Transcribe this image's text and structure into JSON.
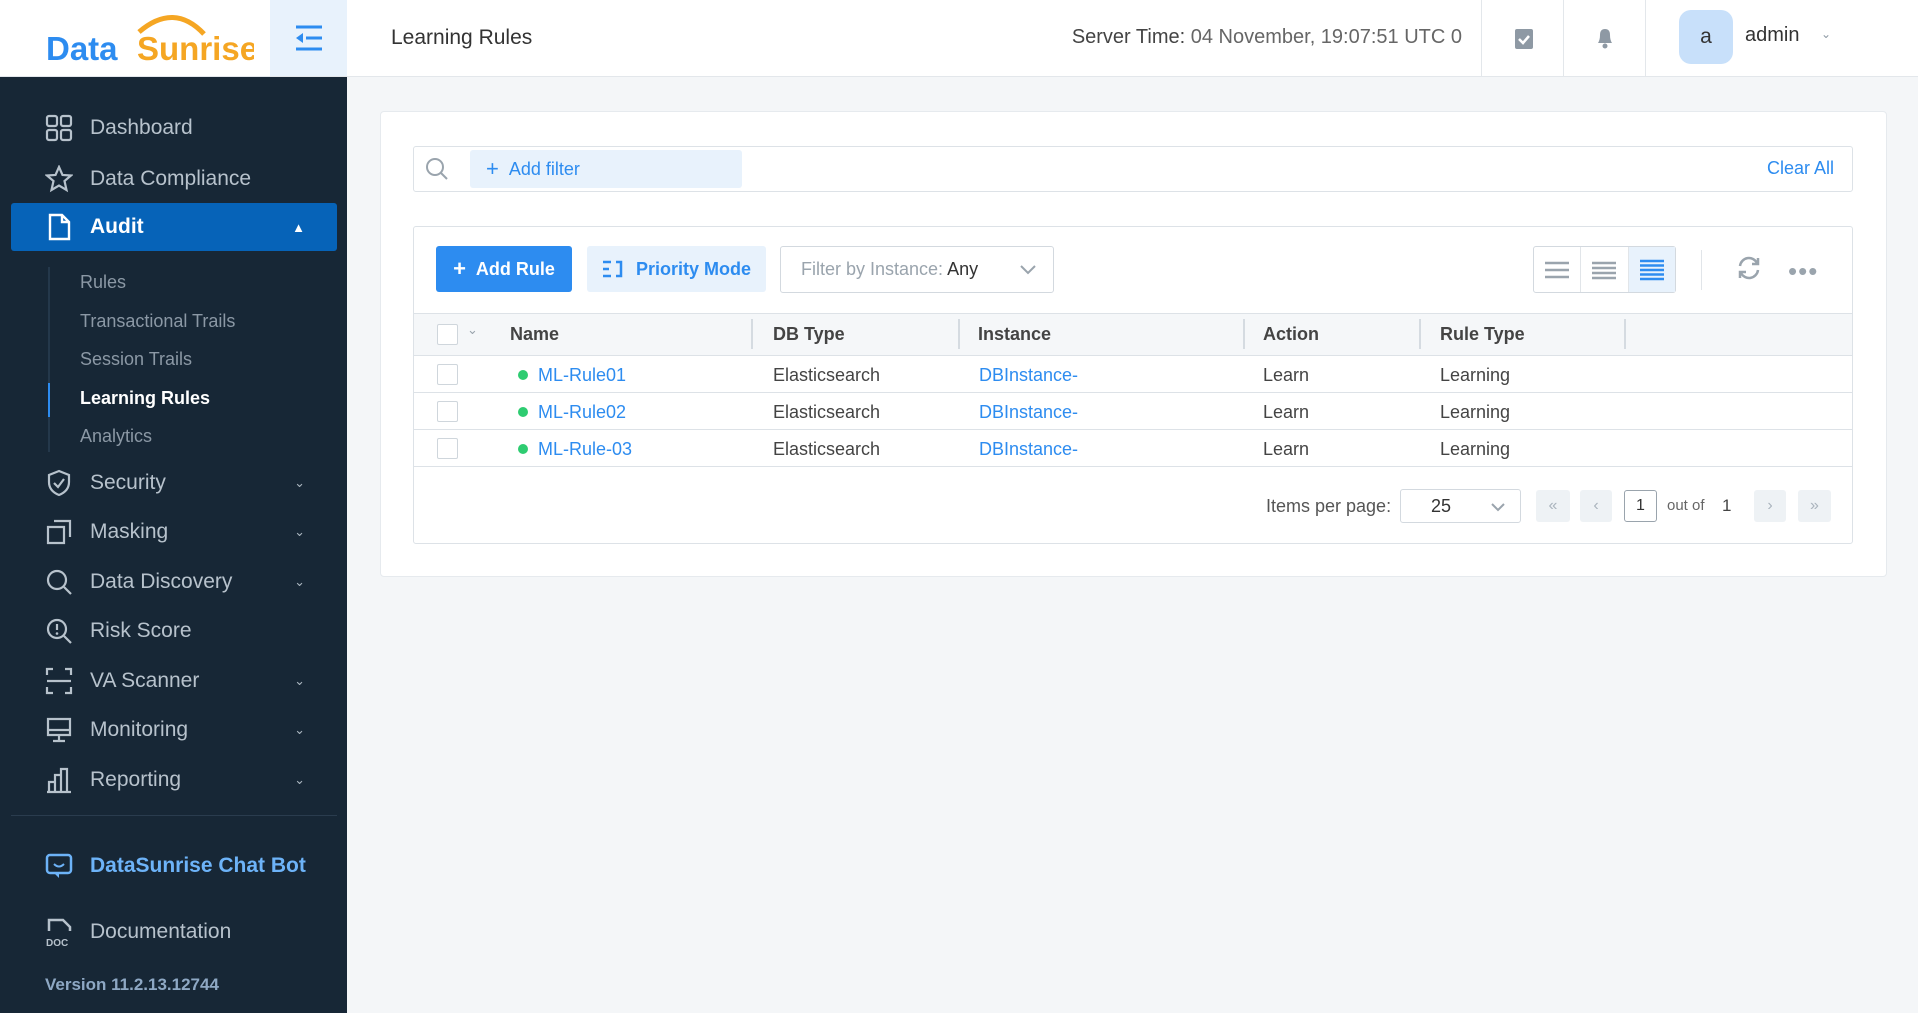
{
  "brand": {
    "part1": "Data",
    "part2": "Sunrise",
    "blue": "#2d8cf0",
    "orange": "#f5a623"
  },
  "header": {
    "title": "Learning Rules",
    "server_label": "Server Time:",
    "server_value": "04 November, 19:07:51  UTC 0",
    "avatar_letter": "a",
    "user": "admin"
  },
  "sidebar": {
    "items": [
      {
        "label": "Dashboard",
        "icon": "grid-icon"
      },
      {
        "label": "Data Compliance",
        "icon": "star-icon"
      },
      {
        "label": "Audit",
        "icon": "document-icon",
        "active": true,
        "expanded": true
      },
      {
        "label": "Security",
        "icon": "shield-icon",
        "chevron": true
      },
      {
        "label": "Masking",
        "icon": "masking-icon",
        "chevron": true
      },
      {
        "label": "Data Discovery",
        "icon": "search-icon",
        "chevron": true
      },
      {
        "label": "Risk Score",
        "icon": "risk-icon"
      },
      {
        "label": "VA Scanner",
        "icon": "scanner-icon",
        "chevron": true
      },
      {
        "label": "Monitoring",
        "icon": "monitor-icon",
        "chevron": true
      },
      {
        "label": "Reporting",
        "icon": "chart-icon",
        "chevron": true
      }
    ],
    "audit_sub": [
      "Rules",
      "Transactional Trails",
      "Session Trails",
      "Learning Rules",
      "Analytics"
    ],
    "chatbot": "DataSunrise Chat Bot",
    "documentation": "Documentation",
    "version": "Version 11.2.13.12744"
  },
  "filter": {
    "add_filter": "Add filter",
    "clear_all": "Clear All"
  },
  "toolbar": {
    "add_rule": "Add Rule",
    "priority_mode": "Priority Mode",
    "instance_label": "Filter by Instance:",
    "instance_value": "Any"
  },
  "table": {
    "columns": [
      "Name",
      "DB Type",
      "Instance",
      "Action",
      "Rule Type"
    ],
    "rows": [
      {
        "name": "ML-Rule01",
        "db_type": "Elasticsearch",
        "instance": "DBInstance-",
        "action": "Learn",
        "rule_type": "Learning",
        "status": "active"
      },
      {
        "name": "ML-Rule02",
        "db_type": "Elasticsearch",
        "instance": "DBInstance-",
        "action": "Learn",
        "rule_type": "Learning",
        "status": "active"
      },
      {
        "name": "ML-Rule-03",
        "db_type": "Elasticsearch",
        "instance": "DBInstance-",
        "action": "Learn",
        "rule_type": "Learning",
        "status": "active"
      }
    ]
  },
  "pagination": {
    "items_label": "Items per page:",
    "items_value": "25",
    "page": "1",
    "out_of": "out of",
    "total": "1"
  }
}
